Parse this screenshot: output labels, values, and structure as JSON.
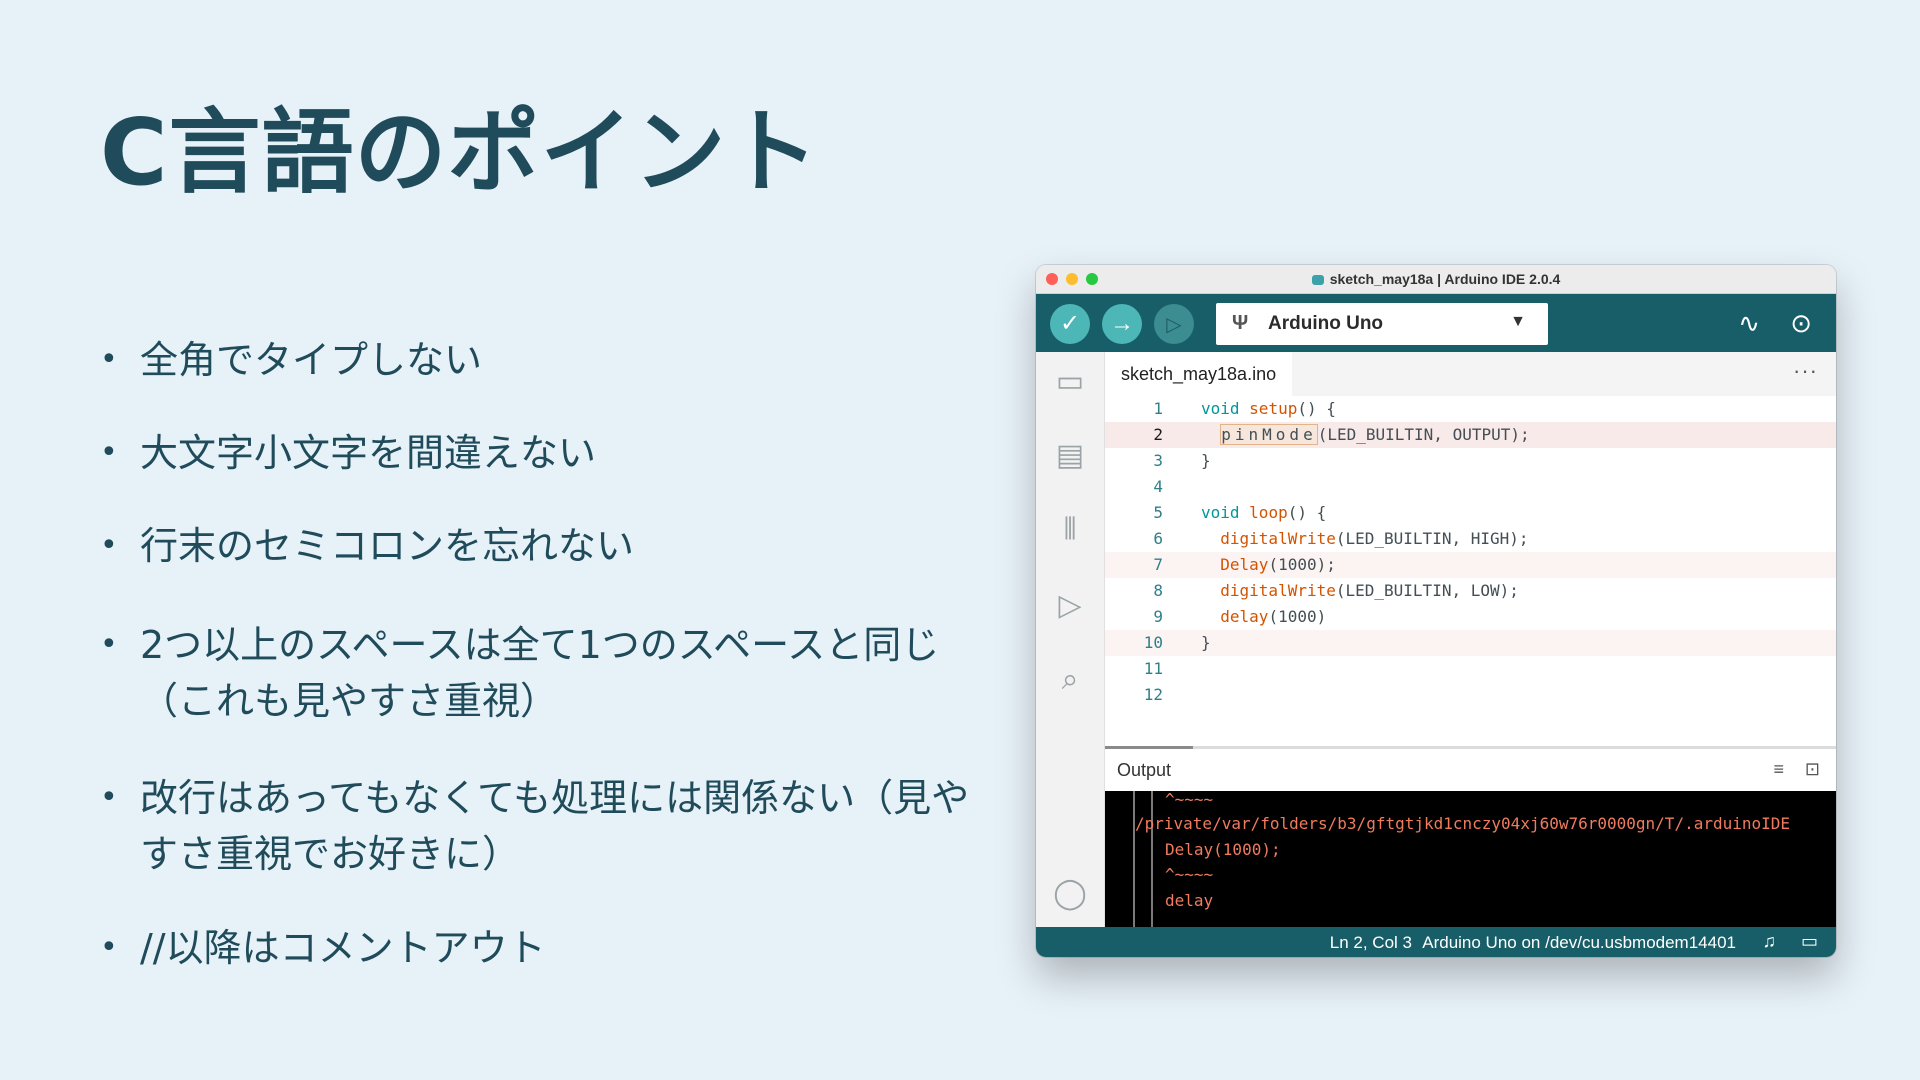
{
  "slide": {
    "title": "C言語のポイント",
    "bullets": [
      "全角でタイプしない",
      "大文字小文字を間違えない",
      "行末のセミコロンを忘れない",
      "2つ以上のスペースは全て1つのスペースと同じ（これも見やすさ重視）",
      "改行はあってもなくても処理には関係ない（見やすさ重視でお好きに）",
      "//以降はコメントアウト"
    ]
  },
  "ide": {
    "window_title": "sketch_may18a | Arduino IDE 2.0.4",
    "board": "Arduino Uno",
    "tab": "sketch_may18a.ino",
    "more": "···",
    "line_numbers": [
      "1",
      "2",
      "3",
      "4",
      "5",
      "6",
      "7",
      "8",
      "9",
      "10",
      "11",
      "12"
    ],
    "output_label": "Output",
    "console_lines": [
      "^~~~~",
      "/private/var/folders/b3/gftgtjkd1cnczy04xj60w76r0000gn/T/.arduinoIDE",
      "Delay(1000);",
      "^~~~~",
      "delay"
    ],
    "status": {
      "position": "Ln 2, Col 3",
      "port": "Arduino Uno on /dev/cu.usbmodem14401"
    },
    "icons": {
      "verify": "check-icon",
      "upload": "arrow-right-icon",
      "debug": "debug-icon",
      "serial_plotter": "plotter-icon",
      "serial_monitor": "monitor-icon"
    },
    "colors": {
      "toolbar": "#175e68",
      "button": "#4db7b7",
      "keyword": "#00979c",
      "function": "#d35400",
      "error": "#f07b5d"
    }
  }
}
